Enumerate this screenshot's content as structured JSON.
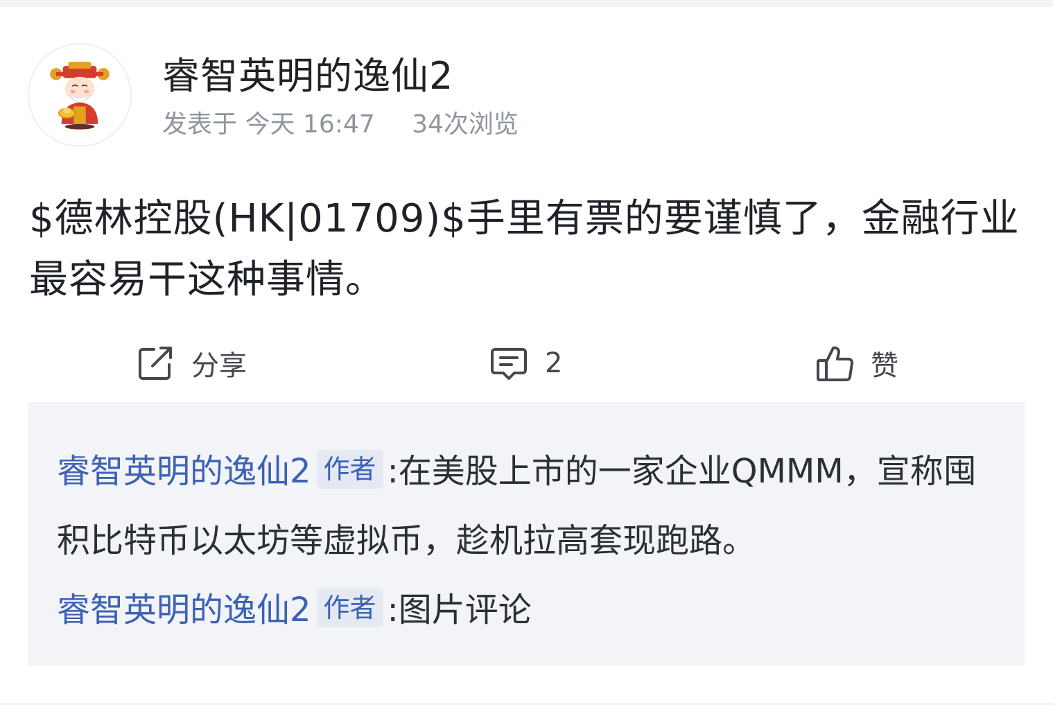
{
  "post": {
    "author": "睿智英明的逸仙2",
    "posted_prefix": "发表于",
    "posted_time": "今天 16:47",
    "views": "34次浏览",
    "content": "$德林控股(HK|01709)$手里有票的要谨慎了，金融行业最容易干这种事情。"
  },
  "actions": {
    "share_label": "分享",
    "comment_count": "2",
    "like_label": "赞"
  },
  "comments": [
    {
      "author": "睿智英明的逸仙2",
      "tag": "作者",
      "text": ":在美股上市的一家企业QMMM，宣称囤积比特币以太坊等虚拟币，趁机拉高套现跑路。"
    },
    {
      "author": "睿智英明的逸仙2",
      "tag": "作者",
      "text": ":图片评论"
    }
  ],
  "colors": {
    "link": "#3c62b4",
    "meta": "#8f959e",
    "comment_bg": "#f2f4f7"
  },
  "icons": [
    "avatar-god-of-wealth",
    "share-icon",
    "comment-icon",
    "thumbs-up-icon"
  ]
}
